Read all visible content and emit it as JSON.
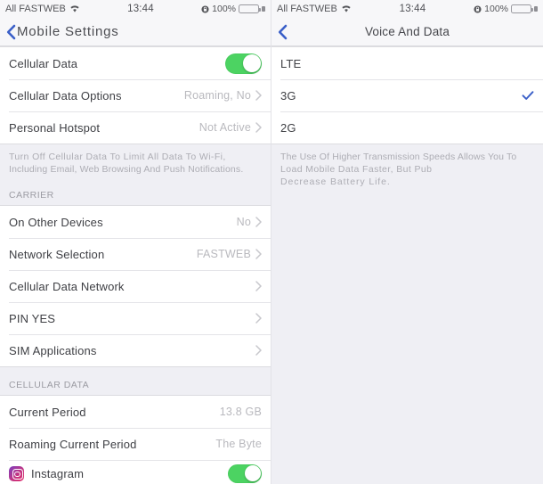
{
  "left": {
    "statusbar": {
      "carrier": "All FASTWEB",
      "wifi_icon": "wifi-icon",
      "time": "13:44",
      "lock_icon": "lock-icon",
      "battery_pct": "100%",
      "battery_icon": "battery-icon"
    },
    "nav": {
      "back_icon": "chevron-left-icon",
      "title": "Mobile Settings"
    },
    "group1": {
      "rows": [
        {
          "label": "Cellular Data",
          "value": "",
          "accessory": "switch",
          "switch_on": true
        },
        {
          "label": "Cellular Data Options",
          "value": "Roaming, No",
          "accessory": "chevron"
        },
        {
          "label": "Personal Hotspot",
          "value": "Not Active",
          "accessory": "chevron"
        }
      ]
    },
    "footer1": {
      "line1": "Turn Off Cellular Data To Limit All Data To Wi-Fi,",
      "line2": "Including Email, Web Browsing And Push Notifications."
    },
    "header_carrier": "CARRIER",
    "group2": {
      "rows": [
        {
          "label": "On Other Devices",
          "value": "No",
          "accessory": "chevron"
        },
        {
          "label": "Network Selection",
          "value": "FASTWEB",
          "accessory": "chevron"
        },
        {
          "label": "Cellular Data Network",
          "value": "",
          "accessory": "chevron"
        },
        {
          "label": "PIN YES",
          "value": "",
          "accessory": "chevron"
        },
        {
          "label": "SIM Applications",
          "value": "",
          "accessory": "chevron"
        }
      ]
    },
    "header_cellular_data": "CELLULAR DATA",
    "group3": {
      "rows": [
        {
          "label": "Current Period",
          "value": "13.8 GB",
          "accessory": "none"
        },
        {
          "label": "Roaming Current Period",
          "value": "The Byte",
          "accessory": "none"
        }
      ],
      "app_row": {
        "label": "Instagram",
        "icon": "instagram-icon",
        "switch_on": true
      }
    }
  },
  "right": {
    "statusbar": {
      "carrier": "All FASTWEB",
      "wifi_icon": "wifi-icon",
      "time": "13:44",
      "lock_icon": "lock-icon",
      "battery_pct": "100%",
      "battery_icon": "battery-icon"
    },
    "nav": {
      "back_icon": "chevron-left-icon",
      "title": "Voice And Data"
    },
    "options": [
      {
        "label": "LTE",
        "selected": false
      },
      {
        "label": "3G",
        "selected": true
      },
      {
        "label": "2G",
        "selected": false
      }
    ],
    "footer": {
      "line1": "The Use Of Higher Transmission Speeds Allows You To",
      "line2": "Load Mobile Data Faster, But Pub",
      "line3": "Decrease Battery Life."
    }
  },
  "colors": {
    "accent_blue": "#3a5fc8",
    "switch_green": "#4cd362",
    "background": "#efeff4",
    "cell_white": "#ffffff",
    "value_gray": "#b9b9be"
  }
}
